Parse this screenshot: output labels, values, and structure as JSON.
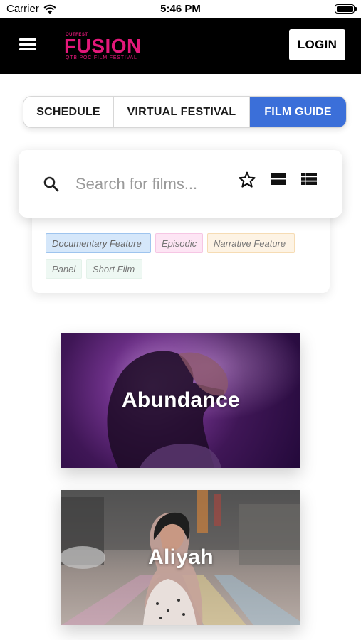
{
  "status_bar": {
    "carrier": "Carrier",
    "time": "5:46 PM"
  },
  "header": {
    "logo": {
      "pre": "OUTFEST",
      "main": "FUSION",
      "sub": "QTBIPOC FILM FESTIVAL"
    },
    "login_label": "LOGIN",
    "accent_color": "#e4187a"
  },
  "tabs": [
    {
      "label": "SCHEDULE",
      "active": false
    },
    {
      "label": "VIRTUAL FESTIVAL",
      "active": false
    },
    {
      "label": "FILM GUIDE",
      "active": true
    }
  ],
  "tab_active_color": "#3b6fd9",
  "search": {
    "placeholder": "Search for films...",
    "value": ""
  },
  "view_controls": [
    "star-icon",
    "grid-view-icon",
    "list-view-icon"
  ],
  "tags": [
    {
      "label": "Documentary Feature",
      "selected": true
    },
    {
      "label": "Episodic",
      "selected": false
    },
    {
      "label": "Narrative Feature",
      "selected": false
    },
    {
      "label": "Panel",
      "selected": false
    },
    {
      "label": "Short Film",
      "selected": false
    }
  ],
  "films": [
    {
      "title": "Abundance"
    },
    {
      "title": "Aliyah"
    }
  ]
}
